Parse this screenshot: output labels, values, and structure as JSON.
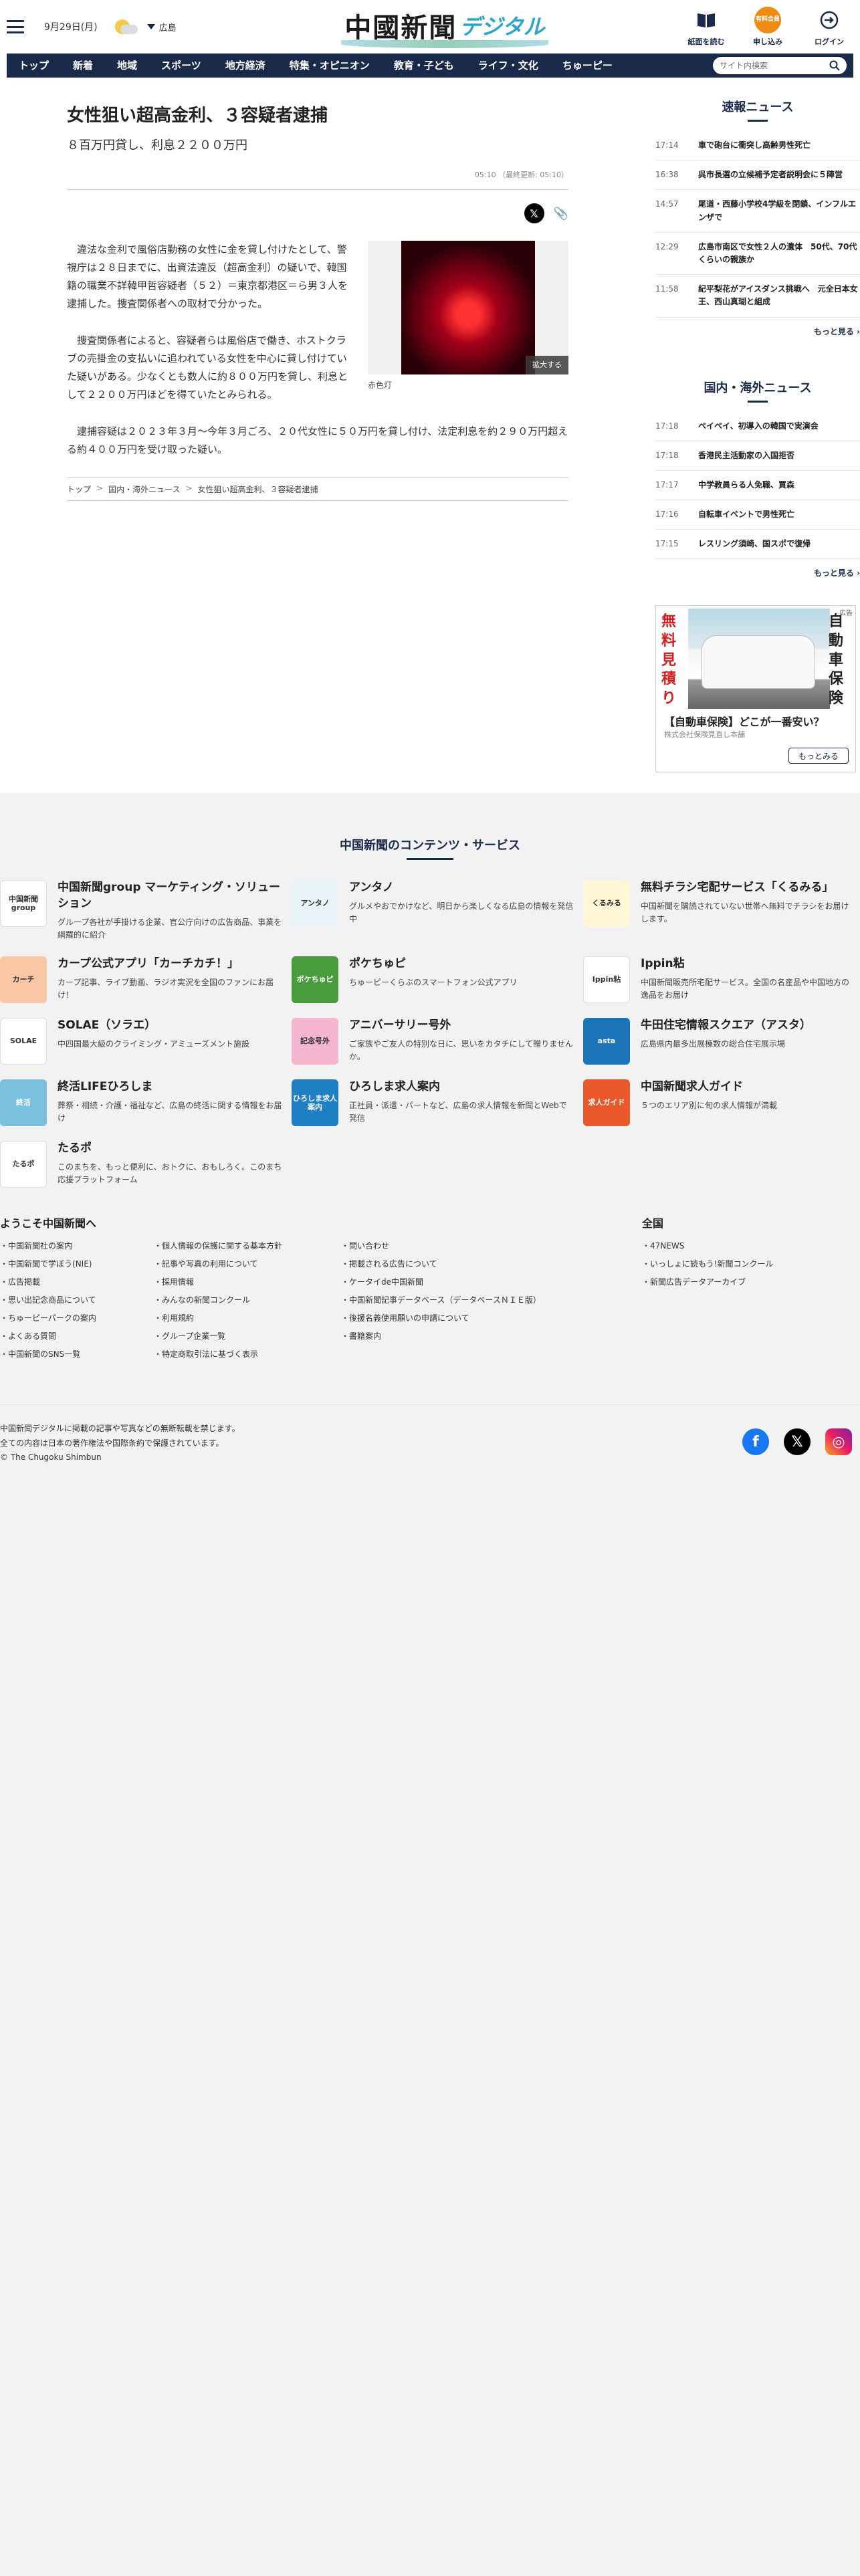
{
  "header": {
    "date": "9月29日(月)",
    "region": "広島",
    "logo_main": "中國新聞",
    "logo_sub": "デジタル",
    "buttons": [
      {
        "label": "紙面を読む",
        "icon": "book-icon"
      },
      {
        "label": "申し込み",
        "icon": "apply-icon",
        "badge": "有料会員"
      },
      {
        "label": "ログイン",
        "icon": "login-icon"
      }
    ]
  },
  "nav": {
    "items": [
      "トップ",
      "新着",
      "地域",
      "スポーツ",
      "地方経済",
      "特集・オピニオン",
      "教育・子ども",
      "ライフ・文化",
      "ちゅーピー"
    ],
    "search_placeholder": "サイト内検索"
  },
  "article": {
    "headline": "女性狙い超高金利、３容疑者逮捕",
    "subhead": "８百万円貸し、利息２２００万円",
    "published": "05:10",
    "updated": "（最終更新: 05:10）",
    "paragraphs": [
      "違法な金利で風俗店勤務の女性に金を貸し付けたとして、警視庁は２８日までに、出資法違反（超高金利）の疑いで、韓国籍の職業不詳韓甲哲容疑者（５２）＝東京都港区＝ら男３人を逮捕した。捜査関係者への取材で分かった。",
      "捜査関係者によると、容疑者らは風俗店で働き、ホストクラブの売掛金の支払いに追われている女性を中心に貸し付けていた疑いがある。少なくとも数人に約８００万円を貸し、利息として２２００万円ほどを得ていたとみられる。",
      "逮捕容疑は２０２３年３月〜今年３月ごろ、２０代女性に５０万円を貸し付け、法定利息を約２９０万円超える約４００万円を受け取った疑い。"
    ],
    "photo_caption": "赤色灯",
    "zoom_label": "拡大する",
    "breadcrumb": [
      "トップ",
      "国内・海外ニュース",
      "女性狙い超高金利、３容疑者逮捕"
    ]
  },
  "sidebar": {
    "breaking": {
      "title": "速報ニュース",
      "items": [
        {
          "time": "17:14",
          "text": "車で砲台に衝突し高齢男性死亡"
        },
        {
          "time": "16:38",
          "text": "呉市長選の立候補予定者説明会に５陣営"
        },
        {
          "time": "14:57",
          "text": "尾道・西藤小学校4学級を閉鎖、インフルエンザで"
        },
        {
          "time": "12:29",
          "text": "広島市南区で女性２人の遺体　50代、70代くらいの親族か"
        },
        {
          "time": "11:58",
          "text": "紀平梨花がアイスダンス挑戦へ　元全日本女王、西山真瑚と組成"
        }
      ],
      "more": "もっと見る"
    },
    "national": {
      "title": "国内・海外ニュース",
      "items": [
        {
          "time": "17:18",
          "text": "ペイペイ、初導入の韓国で実演会"
        },
        {
          "time": "17:18",
          "text": "香港民主活動家の入国拒否"
        },
        {
          "time": "17:17",
          "text": "中学教員らる人免職、買森"
        },
        {
          "time": "17:16",
          "text": "自転車イベントで男性死亡"
        },
        {
          "time": "17:15",
          "text": "レスリング須崎、国スポで復帰"
        }
      ],
      "more": "もっと見る"
    },
    "ad": {
      "left": "無料見積り",
      "right": "自動車保険",
      "headline": "【自動車保険】どこが一番安い？",
      "sponsor": "株式会社保険見直し本舗",
      "button": "もっとみる",
      "badge": "広告"
    }
  },
  "services": {
    "title": "中国新聞のコンテンツ・サービス",
    "items": [
      {
        "title": "中国新聞group マーケティング・ソリューション",
        "desc": "グループ各社が手掛ける企業、官公庁向けの広告商品、事業を網羅的に紹介",
        "icon": "marketing-icon",
        "icon_label": "中国新聞group",
        "color": "#ffffff"
      },
      {
        "title": "アンタノ",
        "desc": "グルメやおでかけなど、明日から楽しくなる広島の情報を発信中",
        "icon": "antano-icon",
        "icon_label": "アンタノ",
        "color": "#e8f4f8"
      },
      {
        "title": "無料チラシ宅配サービス「くるみる」",
        "desc": "中国新聞を購読されていない世帯へ無料でチラシをお届けします。",
        "icon": "kurumiru-icon",
        "icon_label": "くるみる",
        "color": "#fff6d6"
      },
      {
        "title": "カープ公式アプリ「カーチカチ！」",
        "desc": "カープ記事、ライブ動画、ラジオ実況を全国のファンにお届け！",
        "icon": "carp-icon",
        "icon_label": "カーチ",
        "color": "#f9c7a5"
      },
      {
        "title": "ポケちゅピ",
        "desc": "ちゅーピーくらぶのスマートフォン公式アプリ",
        "icon": "pokechupi-icon",
        "icon_label": "ポケちゅピ",
        "color": "#4a9a3e"
      },
      {
        "title": "Ippin粘",
        "desc": "中国新聞販売所宅配サービス。全国の名産品や中国地方の逸品をお届け",
        "icon": "ippin-icon",
        "icon_label": "Ippin粘",
        "color": "#ffffff"
      },
      {
        "title": "SOLAE（ソラエ）",
        "desc": "中四国最大級のクライミング・アミューズメント施設",
        "icon": "solae-icon",
        "icon_label": "SOLAE",
        "color": "#ffffff"
      },
      {
        "title": "アニバーサリー号外",
        "desc": "ご家族やご友人の特別な日に、思いをカタチにして贈りませんか。",
        "icon": "anniversary-icon",
        "icon_label": "記念号外",
        "color": "#f4b6cf"
      },
      {
        "title": "牛田住宅情報スクエア（アスタ）",
        "desc": "広島県内最多出展棟数の総合住宅展示場",
        "icon": "asta-icon",
        "icon_label": "asta",
        "color": "#1c74b9"
      },
      {
        "title": "終活LIFEひろしま",
        "desc": "葬祭・相続・介護・福祉など、広島の終活に関する情報をお届け",
        "icon": "shukatsu-icon",
        "icon_label": "終活",
        "color": "#7cc0e0"
      },
      {
        "title": "ひろしま求人案内",
        "desc": "正社員・派遣・パートなど、広島の求人情報を新聞とWebで発信",
        "icon": "kyujin-annai-icon",
        "icon_label": "ひろしま求人案内",
        "color": "#1f7fc4"
      },
      {
        "title": "中国新聞求人ガイド",
        "desc": "５つのエリア別に旬の求人情報が満載",
        "icon": "kyujin-guide-icon",
        "icon_label": "求人ガイド",
        "color": "#e8582a"
      },
      {
        "title": "たるポ",
        "desc": "このまちを、もっと便利に、おトクに、おもしろく。このまち応援プラットフォーム",
        "icon": "tarupo-icon",
        "icon_label": "たるポ",
        "color": "#ffffff"
      }
    ]
  },
  "footer_links": {
    "welcome_title": "ようこそ中国新聞へ",
    "col1": [
      "中国新聞社の案内",
      "中国新聞で学ぼう(NIE)",
      "広告掲載",
      "思い出記念商品について",
      "ちゅーピーパークの案内",
      "よくある質問",
      "中国新聞のSNS一覧"
    ],
    "col2": [
      "個人情報の保護に関する基本方針",
      "記事や写真の利用について",
      "採用情報",
      "みんなの新聞コンクール",
      "利用規約",
      "グループ企業一覧",
      "特定商取引法に基づく表示"
    ],
    "col3": [
      "問い合わせ",
      "掲載される広告について",
      "ケータイde中国新聞",
      "中国新聞記事データベース（データベースＮＩＥ版）",
      "後援名義使用願いの申請について",
      "書籍案内"
    ],
    "zenkoku_title": "全国",
    "zenkoku": [
      "47NEWS",
      "いっしょに読もう!新聞コンクール",
      "新聞広告データアーカイブ"
    ]
  },
  "copyright": {
    "lines": [
      "中国新聞デジタルに掲載の記事や写真などの無断転載を禁じます。",
      "全ての内容は日本の著作権法や国際条約で保護されています。",
      "© The Chugoku Shimbun"
    ]
  }
}
